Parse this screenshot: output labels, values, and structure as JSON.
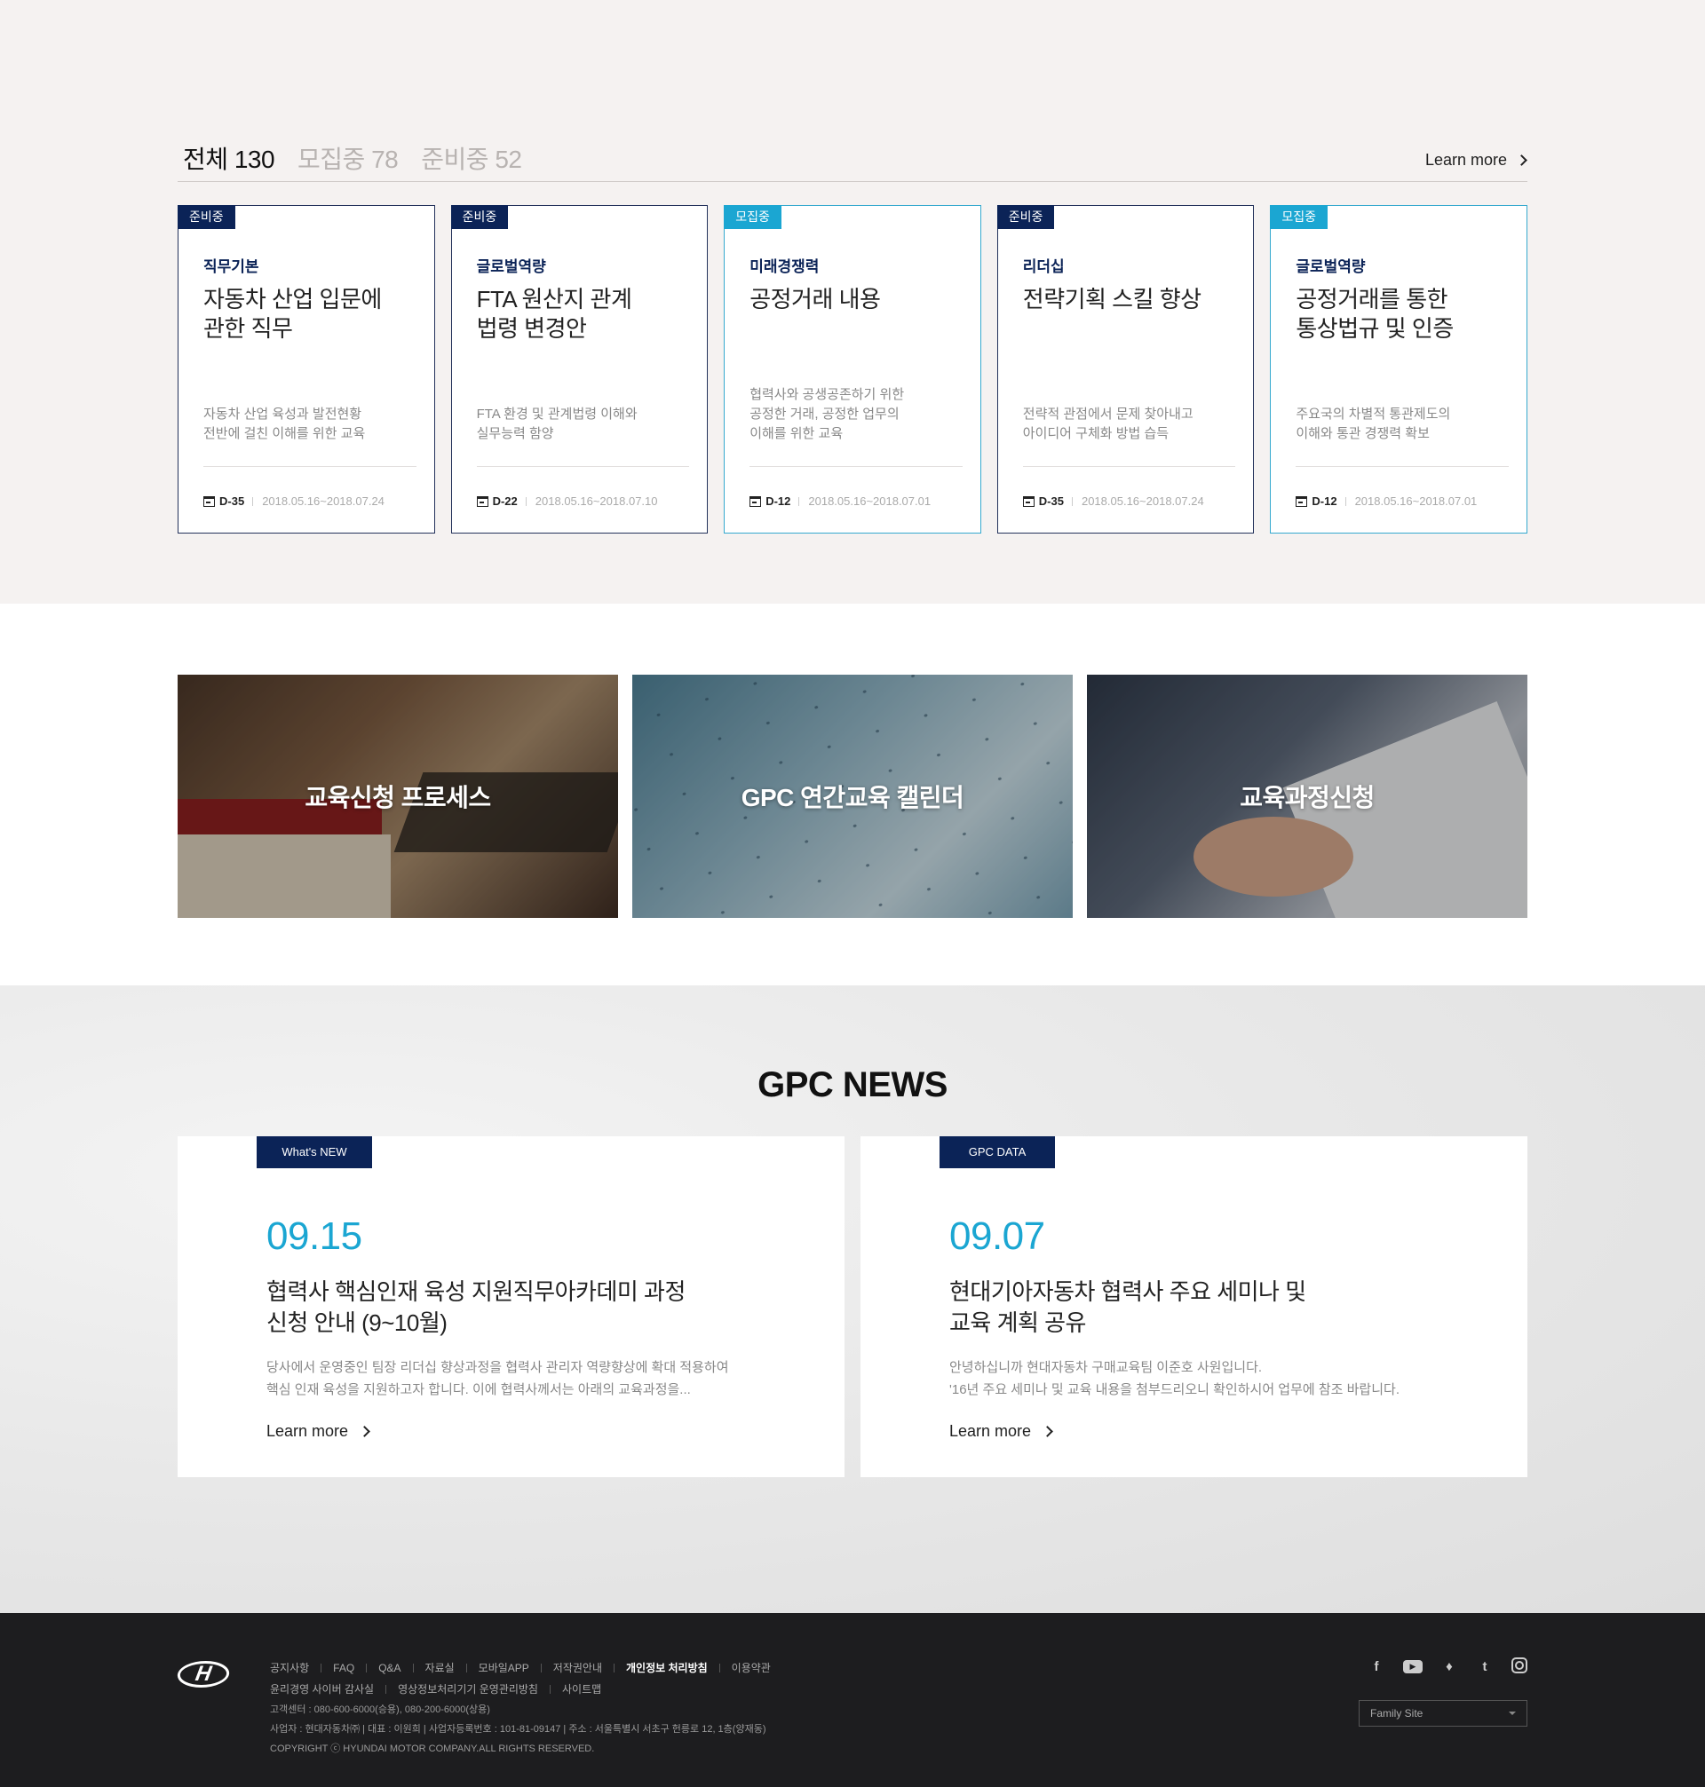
{
  "courses": {
    "tabs": [
      {
        "label": "전체",
        "count": "130"
      },
      {
        "label": "모집중",
        "count": "78"
      },
      {
        "label": "준비중",
        "count": "52"
      }
    ],
    "learn_more": "Learn more",
    "cards": [
      {
        "status": "준비중",
        "category": "직무기본",
        "title_l1": "자동차 산업 입문에",
        "title_l2": "관한 직무",
        "desc_l1": "자동차 산업 육성과 발전현황",
        "desc_l2": "전반에 걸친 이해를 위한 교육",
        "desc_l3": "",
        "dday": "D-35",
        "period": "2018.05.16~2018.07.24"
      },
      {
        "status": "준비중",
        "category": "글로벌역량",
        "title_l1": "FTA 원산지 관계",
        "title_l2": "법령 변경안",
        "desc_l1": "FTA 환경 및 관계법령 이해와",
        "desc_l2": "실무능력 함양",
        "desc_l3": "",
        "dday": "D-22",
        "period": "2018.05.16~2018.07.10"
      },
      {
        "status": "모집중",
        "category": "미래경쟁력",
        "title_l1": "공정거래 내용",
        "title_l2": "",
        "desc_l1": "협력사와 공생공존하기 위한",
        "desc_l2": "공정한 거래, 공정한 업무의",
        "desc_l3": "이해를 위한 교육",
        "dday": "D-12",
        "period": "2018.05.16~2018.07.01"
      },
      {
        "status": "준비중",
        "category": "리더십",
        "title_l1": "전략기획 스킬 향상",
        "title_l2": "",
        "desc_l1": "전략적 관점에서 문제 찾아내고",
        "desc_l2": "아이디어 구체화 방법 습득",
        "desc_l3": "",
        "dday": "D-35",
        "period": "2018.05.16~2018.07.24"
      },
      {
        "status": "모집중",
        "category": "글로벌역량",
        "title_l1": "공정거래를 통한",
        "title_l2": "통상법규 및 인증",
        "desc_l1": "주요국의 차별적 통관제도의",
        "desc_l2": "이해와 통관 경쟁력 확보",
        "desc_l3": "",
        "dday": "D-12",
        "period": "2018.05.16~2018.07.01"
      }
    ]
  },
  "banners": [
    {
      "label": "교육신청 프로세스"
    },
    {
      "label": "GPC 연간교육 캘린더"
    },
    {
      "label": "교육과정신청"
    }
  ],
  "news": {
    "title": "GPC NEWS",
    "items": [
      {
        "badge": "What's NEW",
        "date": "09.15",
        "head_l1": "협력사 핵심인재 육성 지원직무아카데미 과정",
        "head_l2": "신청 안내 (9~10월)",
        "body_l1": "당사에서 운영중인 팀장 리더십 향상과정을 협력사 관리자 역량향상에 확대 적용하여",
        "body_l2": "핵심 인재 육성을 지원하고자 합니다. 이에 협력사께서는 아래의 교육과정을...",
        "more": "Learn more"
      },
      {
        "badge": "GPC DATA",
        "date": "09.07",
        "head_l1": "현대기아자동차 협력사 주요 세미나 및",
        "head_l2": "교육 계획 공유",
        "body_l1": "안녕하십니까 현대자동차 구매교육팀 이준호 사원입니다.",
        "body_l2": "'16년 주요 세미나 및 교육 내용을 첨부드리오니 확인하시어 업무에 참조 바랍니다.",
        "more": "Learn more"
      }
    ]
  },
  "footer": {
    "links_row1": [
      "공지사항",
      "FAQ",
      "Q&A",
      "자료실",
      "모바일APP",
      "저작권안내",
      "개인정보 처리방침",
      "이용약관"
    ],
    "links_row2": [
      "윤리경영 사이버 감사실",
      "영상정보처리기기 운영관리방침",
      "사이트맵"
    ],
    "contact": "고객센터 : 080-600-6000(승용), 080-200-6000(상용)",
    "business": "사업자 : 현대자동차㈜ | 대표 : 이원희 | 사업자등록번호 : 101-81-09147 | 주소 : 서울특별시 서초구 헌릉로 12, 1층(양재동)",
    "copyright": "COPYRIGHT ⓒ HYUNDAI MOTOR COMPANY.ALL RIGHTS RESERVED.",
    "family_site": "Family Site",
    "social": [
      "facebook-icon",
      "youtube-icon",
      "blog-icon",
      "twitter-icon",
      "instagram-icon"
    ]
  },
  "colors": {
    "navy": "#0b2357",
    "accent": "#1ba6d2",
    "footer_bg": "#1d1d1f",
    "section_bg": "#f5f2f1"
  }
}
